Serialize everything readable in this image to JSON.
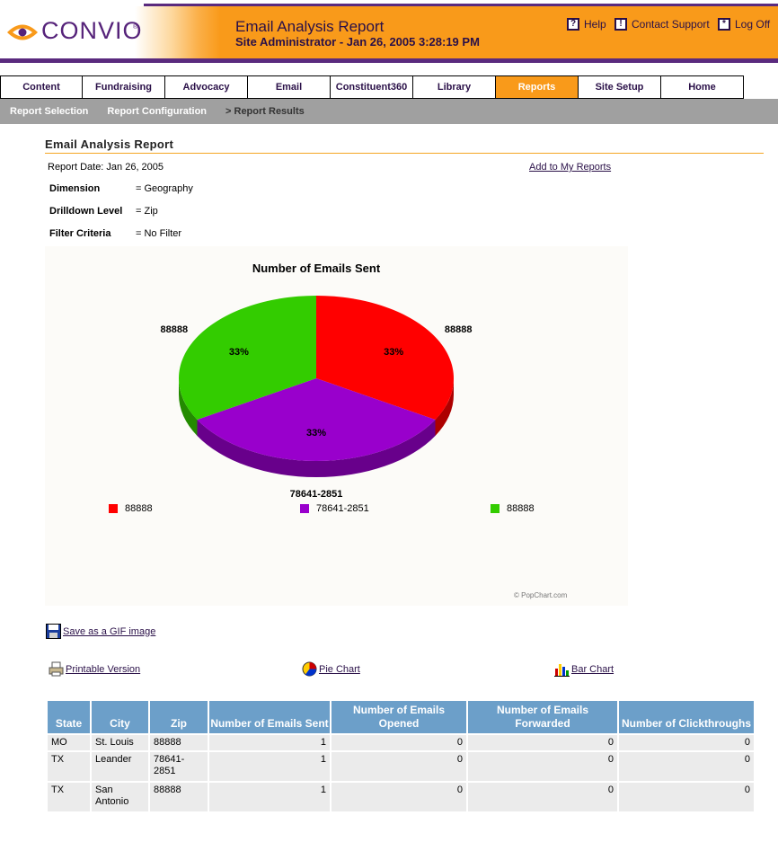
{
  "header": {
    "logo_text": "CONVIO",
    "logo_reg": "®",
    "title": "Email Analysis Report",
    "subtitle": "Site Administrator  -  Jan 26, 2005 3:28:19 PM",
    "links": [
      {
        "label": "Help",
        "icon": "question-icon",
        "glyph": "?"
      },
      {
        "label": "Contact Support",
        "icon": "exclamation-icon",
        "glyph": "!"
      },
      {
        "label": "Log Off",
        "icon": "asterisk-icon",
        "glyph": "*"
      }
    ],
    "colors": {
      "orange": "#f99a1a",
      "purple": "#5a2a7e"
    }
  },
  "nav": {
    "tabs": [
      "Content",
      "Fundraising",
      "Advocacy",
      "Email",
      "Constituent360",
      "Library",
      "Reports",
      "Site Setup",
      "Home"
    ],
    "active": "Reports"
  },
  "subnav": {
    "items": [
      "Report Selection",
      "Report Configuration",
      "> Report Results"
    ]
  },
  "page": {
    "title": "Email Analysis Report",
    "report_date": "Report Date: Jan 26, 2005",
    "add_link": "Add to My Reports",
    "meta": [
      {
        "key": "Dimension",
        "value": "= Geography"
      },
      {
        "key": "Drilldown Level",
        "value": "= Zip"
      },
      {
        "key": "Filter Criteria",
        "value": "= No Filter"
      }
    ]
  },
  "chart_data": {
    "type": "pie",
    "title": "Number of Emails Sent",
    "slices": [
      {
        "label": "88888",
        "value": 1,
        "percent_label": "33%",
        "color": "#ff0000"
      },
      {
        "label": "78641-2851",
        "value": 1,
        "percent_label": "33%",
        "color": "#9900cc"
      },
      {
        "label": "88888",
        "value": 1,
        "percent_label": "33%",
        "color": "#33cc00"
      }
    ],
    "legend": [
      "88888",
      "78641-2851",
      "88888"
    ],
    "legend_placement": "bottom",
    "credit": "© PopChart.com"
  },
  "actions": {
    "save_gif": "Save as a GIF image",
    "printable": "Printable Version",
    "pie": "Pie Chart",
    "bar": "Bar Chart"
  },
  "table": {
    "headers": [
      "State",
      "City",
      "Zip",
      "Number of Emails Sent",
      "Number of Emails Opened",
      "Number of Emails Forwarded",
      "Number of Clickthroughs"
    ],
    "rows": [
      [
        "MO",
        "St. Louis",
        "88888",
        "1",
        "0",
        "0",
        "0"
      ],
      [
        "TX",
        "Leander",
        "78641-2851",
        "1",
        "0",
        "0",
        "0"
      ],
      [
        "TX",
        "San Antonio",
        "88888",
        "1",
        "0",
        "0",
        "0"
      ]
    ]
  }
}
